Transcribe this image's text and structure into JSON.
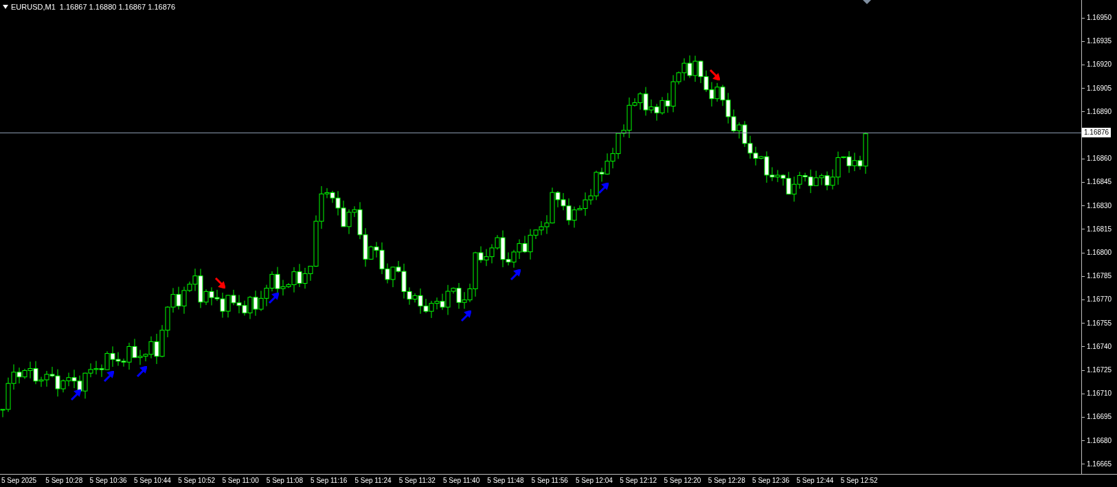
{
  "chart_header": {
    "title": "EURUSD,M1",
    "quote": "1.16867 1.16880 1.16867 1.16876"
  },
  "price_axis": {
    "labels": [
      "1.16950",
      "1.16935",
      "1.16920",
      "1.16905",
      "1.16890",
      "1.16860",
      "1.16845",
      "1.16830",
      "1.16815",
      "1.16800",
      "1.16785",
      "1.16770",
      "1.16755",
      "1.16740",
      "1.16725",
      "1.16710",
      "1.16695",
      "1.16680",
      "1.16665"
    ],
    "current_price": "1.16876"
  },
  "time_axis": {
    "labels": [
      "5 Sep 2025",
      "5 Sep 10:28",
      "5 Sep 10:36",
      "5 Sep 10:44",
      "5 Sep 10:52",
      "5 Sep 11:00",
      "5 Sep 11:08",
      "5 Sep 11:16",
      "5 Sep 11:24",
      "5 Sep 11:32",
      "5 Sep 11:40",
      "5 Sep 11:48",
      "5 Sep 11:56",
      "5 Sep 12:04",
      "5 Sep 12:12",
      "5 Sep 12:20",
      "5 Sep 12:28",
      "5 Sep 12:36",
      "5 Sep 12:44",
      "5 Sep 12:52"
    ]
  }
}
